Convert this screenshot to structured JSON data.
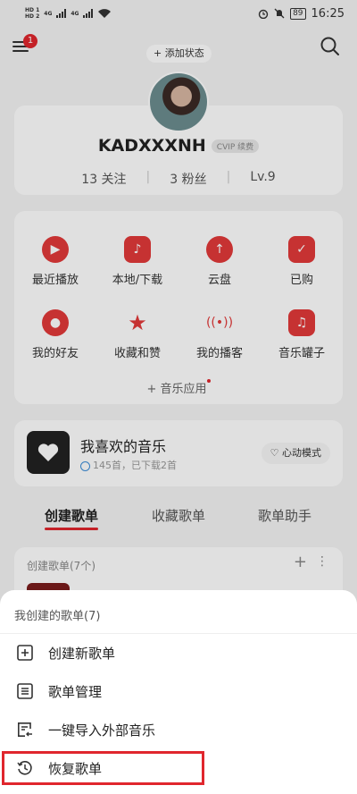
{
  "status_bar": {
    "sim1": "HD 1",
    "sim2": "HD 2",
    "net1": "4G",
    "net2": "4G",
    "battery": "89",
    "time": "16:25"
  },
  "nav": {
    "badge_count": "1",
    "add_status_label": "+ 添加状态"
  },
  "profile": {
    "username": "KADXXXNH",
    "vip_label": "CVIP 续费",
    "following": "13 关注",
    "followers": "3 粉丝",
    "level": "Lv.9"
  },
  "quick_grid": {
    "items": [
      {
        "label": "最近播放",
        "icon": "play-icon"
      },
      {
        "label": "本地/下载",
        "icon": "music-file-icon"
      },
      {
        "label": "云盘",
        "icon": "cloud-upload-icon"
      },
      {
        "label": "已购",
        "icon": "shopping-bag-icon"
      },
      {
        "label": "我的好友",
        "icon": "person-icon"
      },
      {
        "label": "收藏和赞",
        "icon": "star-icon"
      },
      {
        "label": "我的播客",
        "icon": "broadcast-icon"
      },
      {
        "label": "音乐罐子",
        "icon": "jar-icon"
      }
    ],
    "music_app_label": "+ 音乐应用"
  },
  "liked": {
    "title": "我喜欢的音乐",
    "subtitle": "145首，已下载2首",
    "mode_label": "心动模式"
  },
  "tabs": {
    "created": "创建歌单",
    "collected": "收藏歌单",
    "assistant": "歌单助手"
  },
  "playlist_section": {
    "header": "创建歌单(7个)"
  },
  "sheet": {
    "title": "我创建的歌单(7)",
    "options": [
      {
        "label": "创建新歌单",
        "icon": "plus-square-icon"
      },
      {
        "label": "歌单管理",
        "icon": "list-icon"
      },
      {
        "label": "一键导入外部音乐",
        "icon": "import-icon"
      },
      {
        "label": "恢复歌单",
        "icon": "history-icon"
      }
    ]
  },
  "colors": {
    "accent": "#e0262d",
    "highlight_box": "#e0262d"
  }
}
